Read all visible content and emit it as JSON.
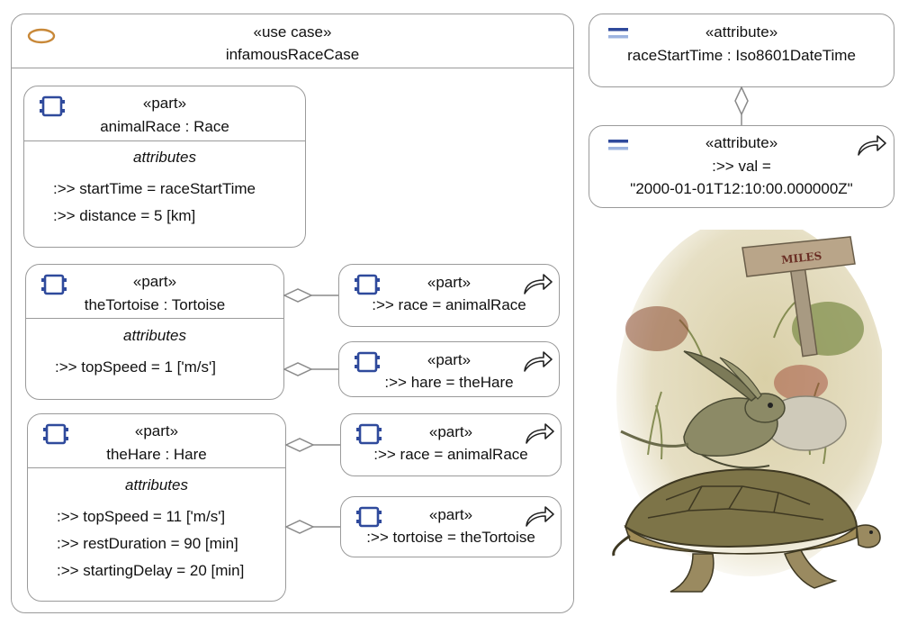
{
  "usecase": {
    "stereotype": "«use case»",
    "name": "infamousRaceCase"
  },
  "animalRace": {
    "stereotype": "«part»",
    "name": "animalRace : Race",
    "section": "attributes",
    "attrs": [
      ":>> startTime = raceStartTime",
      ":>> distance = 5 [km]"
    ]
  },
  "tortoise": {
    "stereotype": "«part»",
    "name": "theTortoise : Tortoise",
    "section": "attributes",
    "attrs": [
      ":>> topSpeed = 1 ['m/s']"
    ]
  },
  "hare": {
    "stereotype": "«part»",
    "name": "theHare : Hare",
    "section": "attributes",
    "attrs": [
      ":>> topSpeed = 11 ['m/s']",
      ":>> restDuration = 90 [min]",
      ":>> startingDelay = 20 [min]"
    ]
  },
  "tortoiseRace": {
    "stereotype": "«part»",
    "name": ":>> race = animalRace"
  },
  "tortoiseHare": {
    "stereotype": "«part»",
    "name": ":>> hare = theHare"
  },
  "hareRace": {
    "stereotype": "«part»",
    "name": ":>> race = animalRace"
  },
  "hareTortoise": {
    "stereotype": "«part»",
    "name": ":>> tortoise = theTortoise"
  },
  "raceStartTime": {
    "stereotype": "«attribute»",
    "name": "raceStartTime : Iso8601DateTime"
  },
  "val": {
    "stereotype": "«attribute»",
    "line1": ":>> val =",
    "line2": "\"2000-01-01T12:10:00.000000Z\""
  },
  "illustration": {
    "signpost_text": "MILES"
  },
  "colors": {
    "border": "#9a9a9a",
    "part_icon": "#2f4a9c",
    "usecase_icon": "#c88838",
    "attribute_icon_dark": "#2f4a9c",
    "attribute_icon_light": "#9db4e0"
  },
  "icons": {
    "usecase": "use-case-ellipse-icon",
    "part": "part-block-icon",
    "attribute": "attribute-lines-icon",
    "redefine": "curved-arrow-icon"
  }
}
